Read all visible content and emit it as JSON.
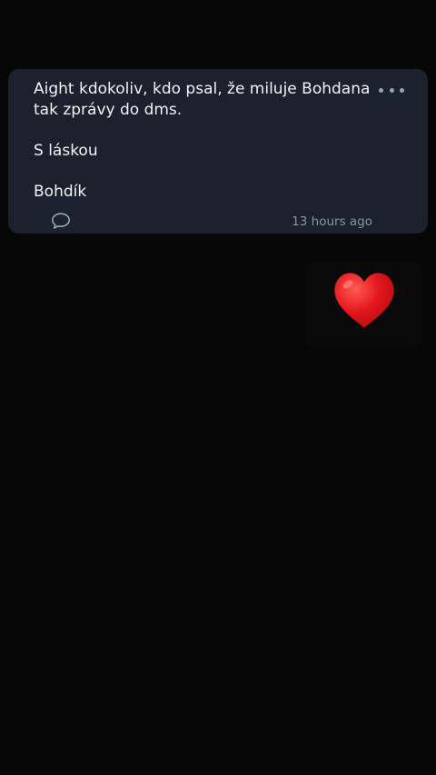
{
  "post": {
    "paragraphs": [
      [
        "Aight kdokoliv, kdo psal, že miluje Bohdana",
        "tak zprávy do dms."
      ],
      [
        "S láskou"
      ],
      [
        "Bohdík"
      ]
    ],
    "timestamp": "13 hours ago",
    "icons": {
      "more": "more-horizontal-icon",
      "comment": "comment-bubble-icon"
    }
  },
  "sticker": {
    "icon": "red-heart-icon",
    "color": "#e0151b"
  },
  "colors": {
    "background": "#070707",
    "card": "#1c222d",
    "text": "#f2f3f5",
    "muted": "#8a93a0"
  }
}
